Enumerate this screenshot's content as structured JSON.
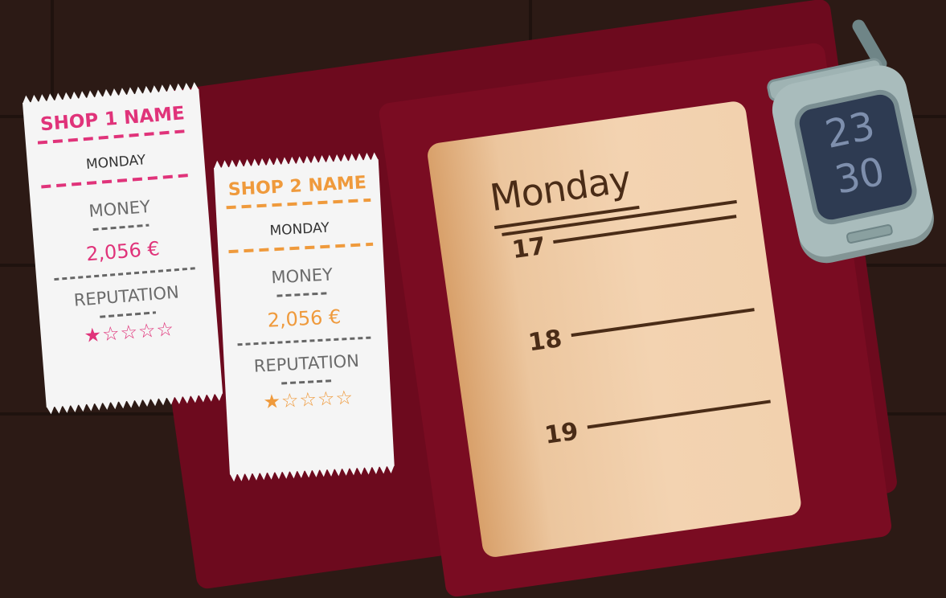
{
  "receipts": [
    {
      "shop": "SHOP 1 NAME",
      "day": "MONDAY",
      "money_label": "MONEY",
      "money": "2,056 €",
      "reputation_label": "REPUTATION",
      "rating": 1,
      "max_rating": 5,
      "accent": "#e0337a"
    },
    {
      "shop": "SHOP 2 NAME",
      "day": "MONDAY",
      "money_label": "MONEY",
      "money": "2,056 €",
      "reputation_label": "REPUTATION",
      "rating": 1,
      "max_rating": 5,
      "accent": "#ef9a3c"
    }
  ],
  "planner": {
    "day": "Monday",
    "hours": [
      "17",
      "18",
      "19"
    ]
  },
  "phone": {
    "hour": "23",
    "minute": "30"
  },
  "colors": {
    "background": "#2c1a15",
    "planner_cover": "#6d0a1e",
    "page": "#f2d1ae",
    "ink": "#4a2c17",
    "phone": "#a9bcbc",
    "phone_screen": "#2e3b52"
  }
}
